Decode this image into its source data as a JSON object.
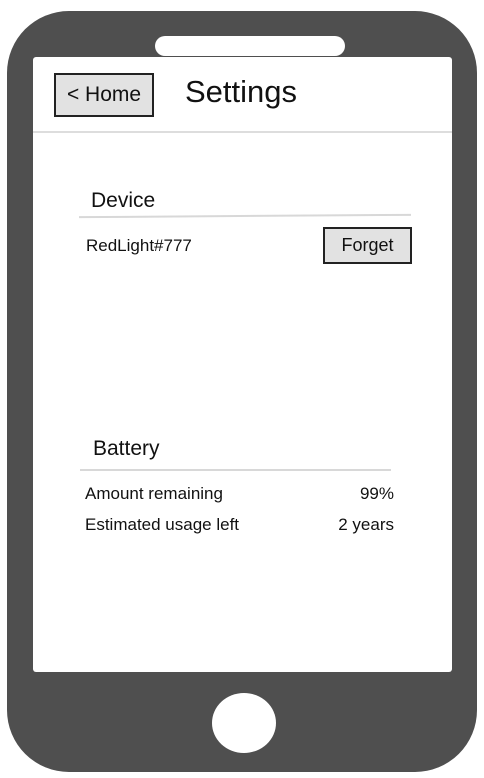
{
  "header": {
    "back_label": "< Home",
    "title": "Settings"
  },
  "device": {
    "title": "Device",
    "name": "RedLight#777",
    "forget_label": "Forget"
  },
  "battery": {
    "title": "Battery",
    "rows": [
      {
        "label": "Amount remaining",
        "value": "99%"
      },
      {
        "label": "Estimated usage left",
        "value": "2 years"
      }
    ]
  },
  "colors": {
    "phone_body": "#4f4f4f",
    "button_fill": "#e2e2e2",
    "divider": "#dddddd"
  }
}
